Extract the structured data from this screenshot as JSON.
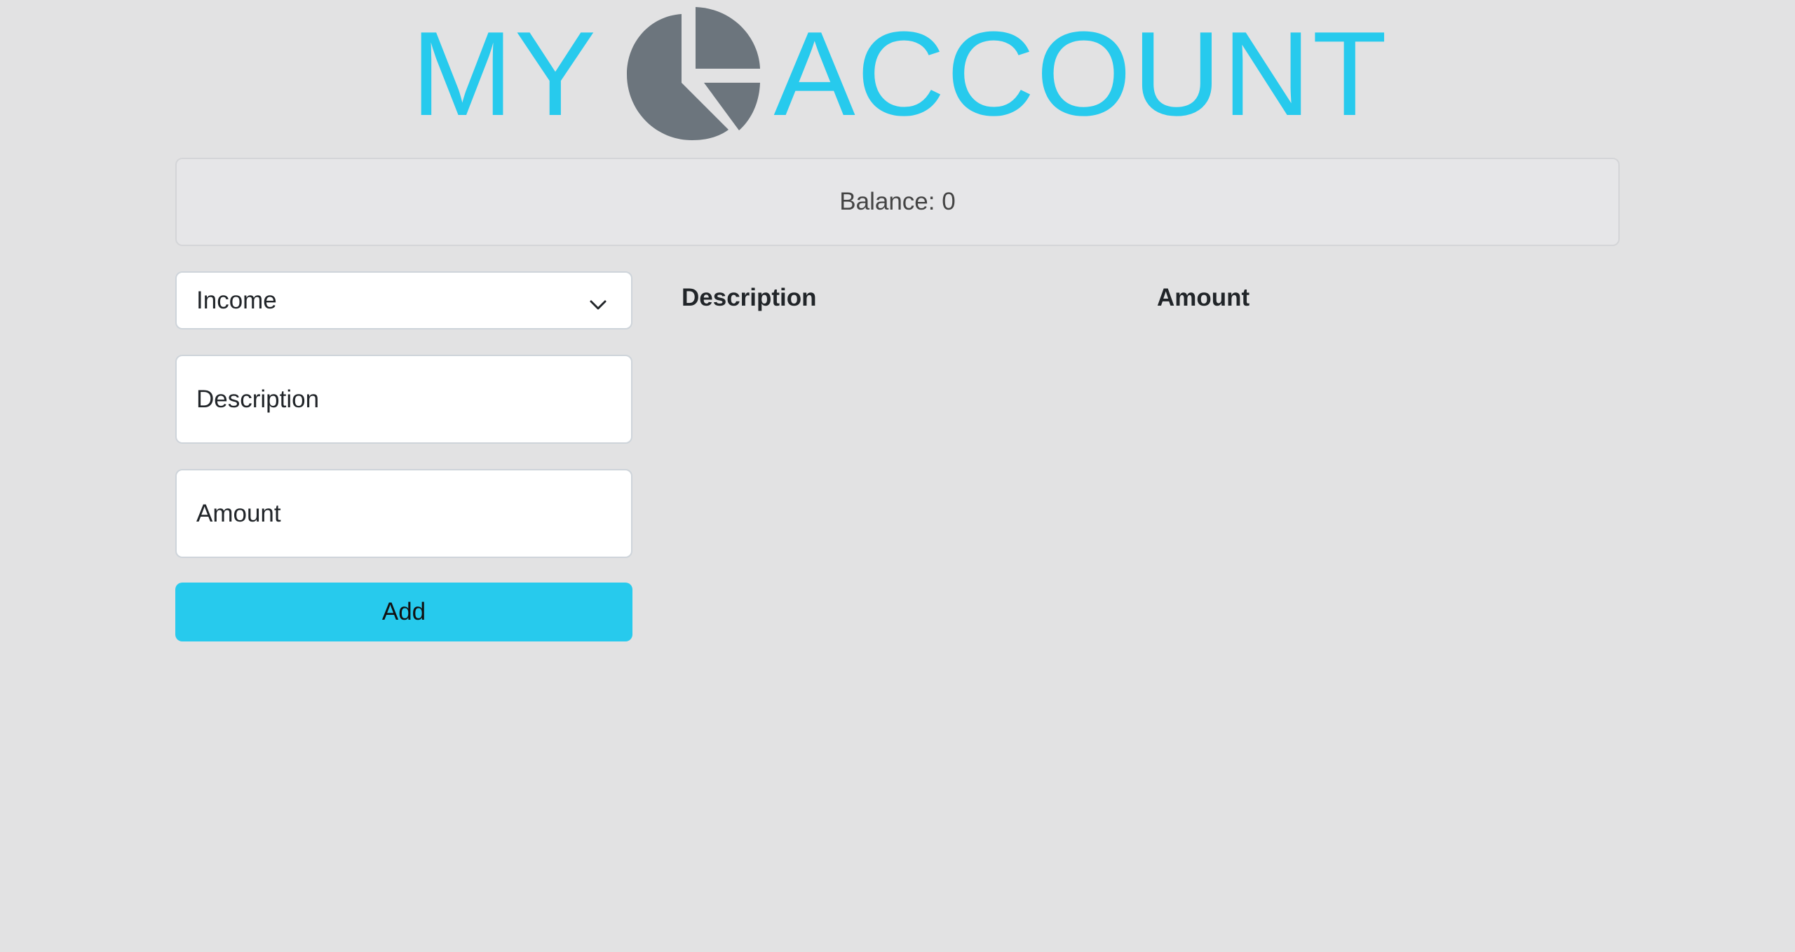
{
  "header": {
    "title_left": "MY",
    "title_right": "ACCOUNT",
    "logo_icon": "pie-chart-icon",
    "title_color": "#27caed",
    "icon_color": "#6c757d"
  },
  "balance": {
    "label": "Balance:",
    "value": "0"
  },
  "form": {
    "type_select": {
      "selected": "Income"
    },
    "description_placeholder": "Description",
    "amount_placeholder": "Amount",
    "add_label": "Add",
    "accent_color": "#27caed"
  },
  "table": {
    "columns": [
      "Description",
      "Amount"
    ],
    "rows": []
  }
}
